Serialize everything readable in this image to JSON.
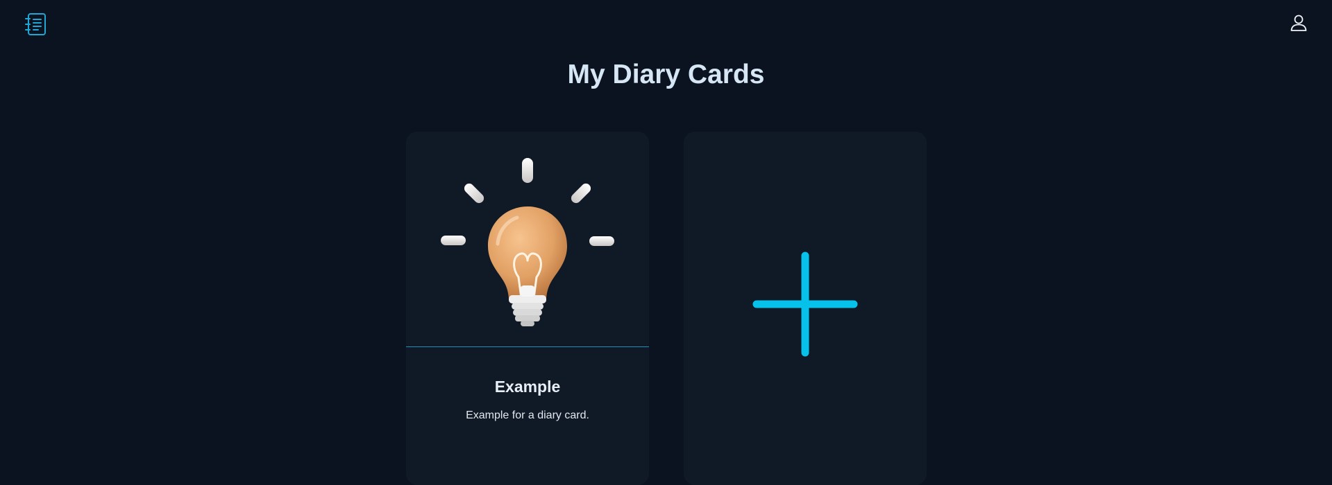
{
  "header": {
    "logo_icon": "notebook-list-icon",
    "user_icon": "user-profile-icon",
    "accent_color": "#1fa8d6"
  },
  "page": {
    "title": "My Diary Cards"
  },
  "cards": [
    {
      "image_icon": "lightbulb-illustration",
      "title": "Example",
      "description": "Example for a diary card."
    }
  ],
  "add_card": {
    "icon": "plus-icon",
    "color": "#06c1ea"
  }
}
